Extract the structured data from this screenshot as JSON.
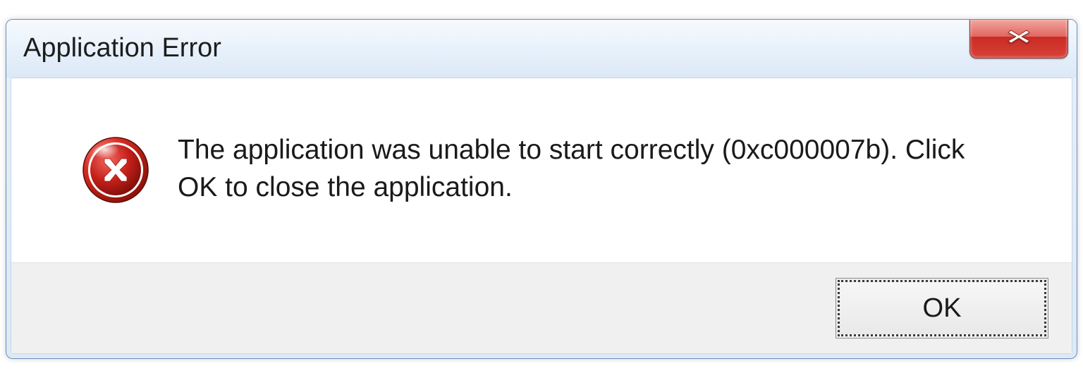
{
  "dialog": {
    "title": "Application Error",
    "message": "The application was unable to start correctly (0xc000007b). Click OK to close the application.",
    "ok_label": "OK"
  }
}
